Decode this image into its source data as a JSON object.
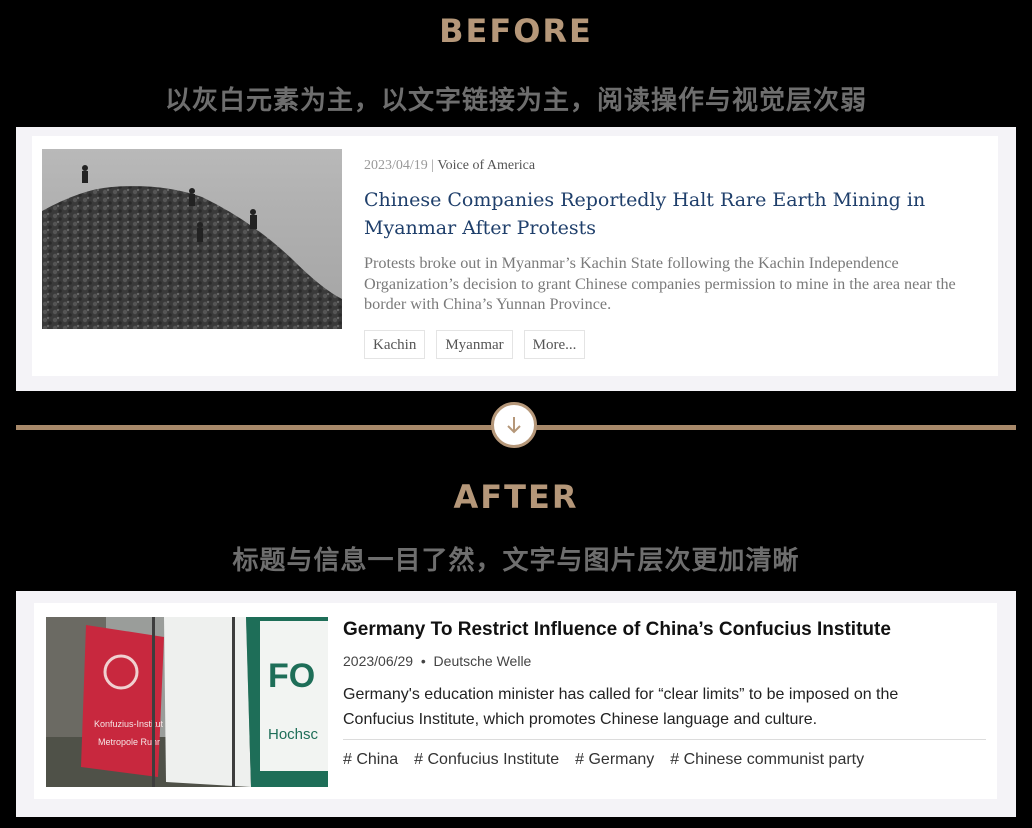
{
  "before": {
    "heading": "BEFORE",
    "subtitle": "以灰白元素为主，以文字链接为主，阅读操作与视觉层次弱",
    "card": {
      "date": "2023/04/19",
      "separator": "|",
      "source": "Voice of America",
      "title": "Chinese Companies Reportedly Halt Rare Earth Mining in Myanmar After Protests",
      "description": "Protests broke out in Myanmar’s Kachin State following the Kachin Independence Organization’s decision to grant Chinese companies permission to mine in the area near the border with China’s Yunnan Province.",
      "tags": [
        "Kachin",
        "Myanmar",
        "More..."
      ],
      "image": "mining-workers-photo"
    }
  },
  "after": {
    "heading": "AFTER",
    "subtitle": "标题与信息一目了然，文字与图片层次更加清晰",
    "card": {
      "title": "Germany To Restrict Influence of China’s Confucius Institute",
      "date": "2023/06/29",
      "bullet": "•",
      "source": "Deutsche Welle",
      "description": "Germany's education minister has called for “clear limits” to be imposed on the Confucius Institute, which promotes Chinese language and culture.",
      "tags": [
        "# China",
        "# Confucius Institute",
        "# Germany",
        "# Chinese communist party"
      ],
      "image": "confucius-institute-flags-photo",
      "image_text_1": "Konfuzius-Institut",
      "image_text_2": "Metropole Ruhr",
      "image_text_3": "FO",
      "image_text_4": "Hochsc"
    }
  },
  "divider": {
    "icon": "arrow-down-icon",
    "accent": "#b59779"
  },
  "colors": {
    "accent": "#b59779",
    "title_blue": "#1f3f6b",
    "background": "#000000"
  }
}
